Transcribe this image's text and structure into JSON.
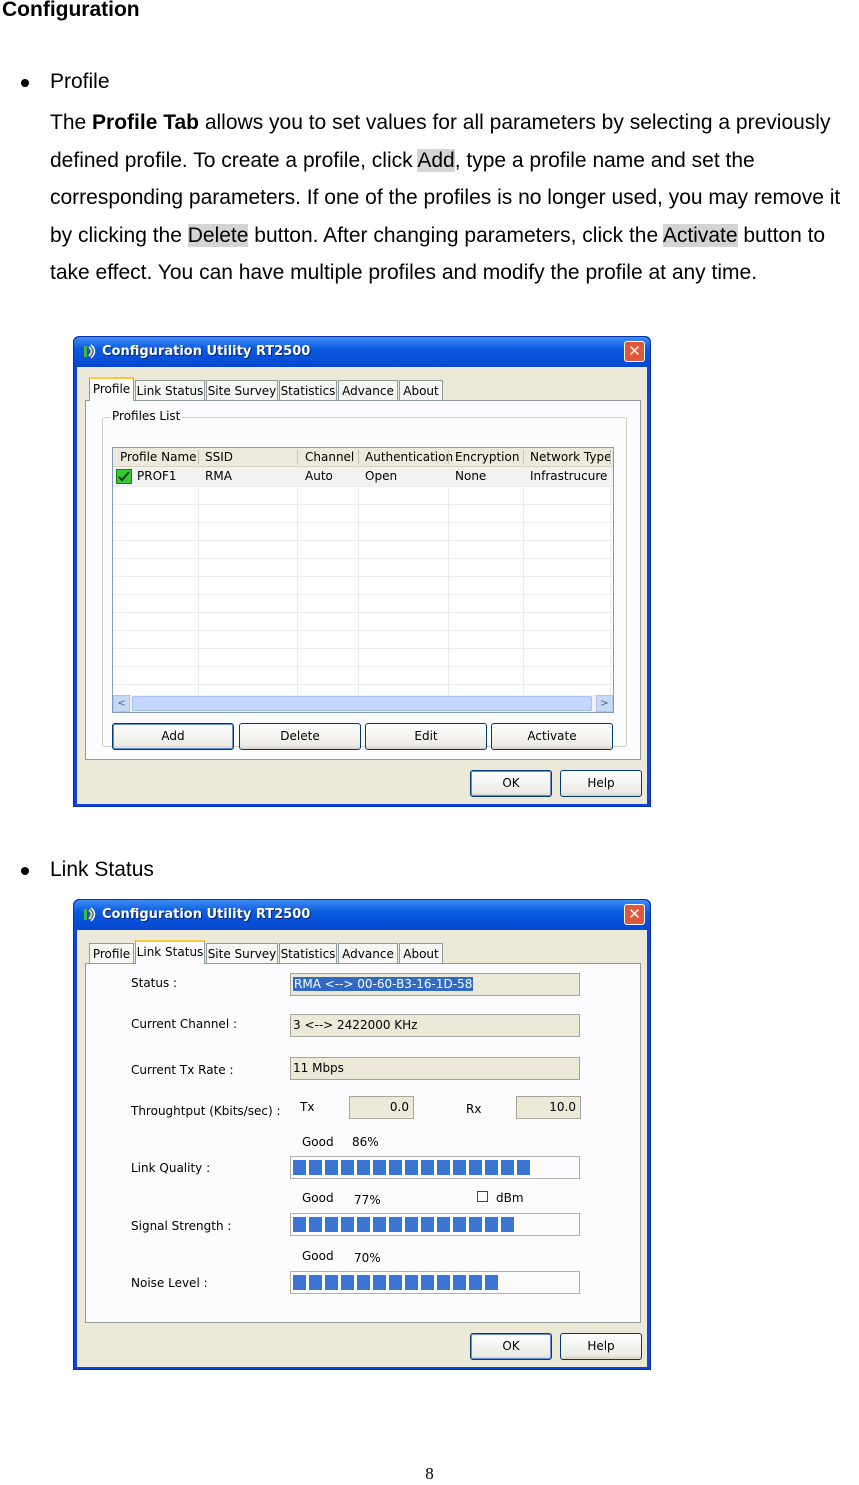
{
  "heading": "Configuration",
  "page_number": "8",
  "profile_section": {
    "bullet": "Profile",
    "para": {
      "t1": "The ",
      "b1": "Profile Tab",
      "t2": " allows you to set values for all parameters by selecting a previously defined profile. To create a profile, click ",
      "hl1": "Add",
      "t3": ", type a profile name and set the corresponding parameters. If one of the profiles is no longer used, you may remove it by clicking the ",
      "hl2": "Delete",
      "t4": " button. After changing parameters, click the ",
      "hl3": "Activate",
      "t5": " button to take effect. You can have multiple profiles and modify the profile at any time."
    }
  },
  "link_section": {
    "bullet": "Link Status"
  },
  "window": {
    "title": "Configuration Utility RT2500",
    "close": "✕",
    "tabs": [
      "Profile",
      "Link Status",
      "Site Survey",
      "Statistics",
      "Advance",
      "About"
    ],
    "ok": "OK",
    "help": "Help"
  },
  "profiles": {
    "group_label": "Profiles List",
    "columns": [
      "Profile Name",
      "SSID",
      "Channel",
      "Authentication",
      "Encryption",
      "Network Type"
    ],
    "rows": [
      [
        "PROF1",
        "RMA",
        "Auto",
        "Open",
        "None",
        "Infrastrucure"
      ]
    ],
    "scroll_left": "<",
    "scroll_right": ">",
    "buttons": {
      "add": "Add",
      "delete": "Delete",
      "edit": "Edit",
      "activate": "Activate"
    }
  },
  "link_status": {
    "status_label": "Status :",
    "status_value": "RMA <--> 00-60-B3-16-1D-58",
    "channel_label": "Current Channel :",
    "channel_value": "3 <--> 2422000 KHz",
    "txrate_label": "Current Tx Rate :",
    "txrate_value": "11 Mbps",
    "throughput_label": "Throughtput (Kbits/sec) :",
    "tx_label": "Tx",
    "tx_value": "0.0",
    "rx_label": "Rx",
    "rx_value": "10.0",
    "link_quality": {
      "label": "Link Quality :",
      "grade": "Good",
      "percent": "86%",
      "level": 0.86
    },
    "signal_strength": {
      "label": "Signal Strength :",
      "grade": "Good",
      "percent": "77%",
      "level": 0.77
    },
    "noise_level": {
      "label": "Noise Level :",
      "grade": "Good",
      "percent": "70%",
      "level": 0.7
    },
    "dbm_label": "dBm",
    "dbm_checked": false
  }
}
